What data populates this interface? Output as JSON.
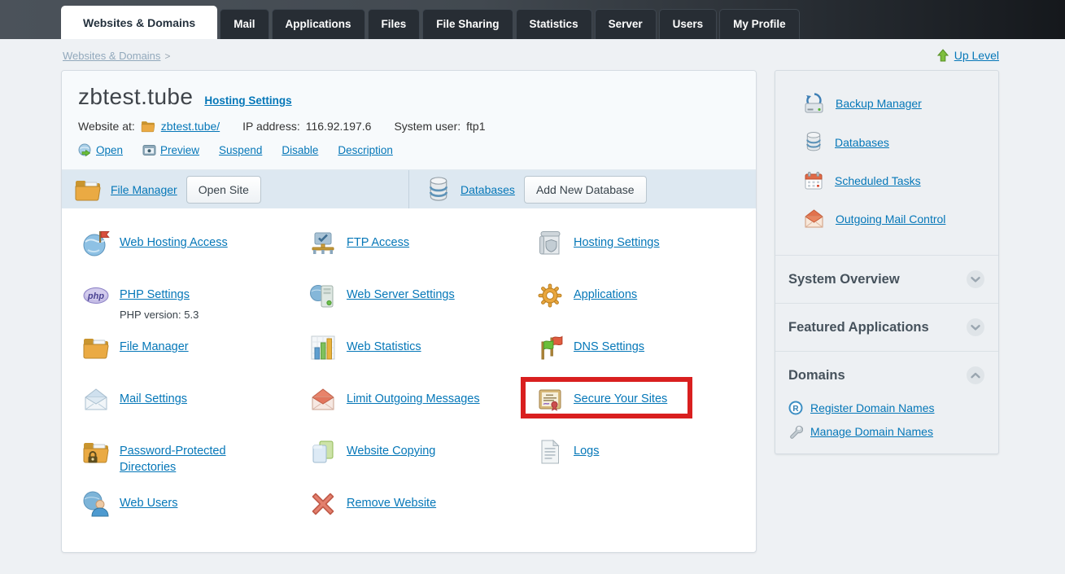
{
  "header": {
    "tabs": [
      {
        "label": "Websites & Domains",
        "active": true
      },
      {
        "label": "Mail",
        "active": false
      },
      {
        "label": "Applications",
        "active": false
      },
      {
        "label": "Files",
        "active": false
      },
      {
        "label": "File Sharing",
        "active": false
      },
      {
        "label": "Statistics",
        "active": false
      },
      {
        "label": "Server",
        "active": false
      },
      {
        "label": "Users",
        "active": false
      },
      {
        "label": "My Profile",
        "active": false
      }
    ]
  },
  "breadcrumb": {
    "current": "Websites & Domains",
    "separator": ">",
    "up_level": "Up Level"
  },
  "domain_card": {
    "title": "zbtest.tube",
    "hosting_settings_link": "Hosting Settings",
    "website_at_label": "Website at:",
    "website_path": "zbtest.tube/",
    "ip_label": "IP address:",
    "ip_value": "116.92.197.6",
    "system_user_label": "System user:",
    "system_user_value": "ftp1",
    "actions": [
      "Open",
      "Preview",
      "Suspend",
      "Disable",
      "Description"
    ],
    "toolbar": {
      "file_manager": "File Manager",
      "open_site": "Open Site",
      "databases": "Databases",
      "add_new_database": "Add New Database"
    },
    "grid": [
      {
        "label": "Web Hosting Access"
      },
      {
        "label": "PHP Settings",
        "sub": "PHP version: 5.3"
      },
      {
        "label": "File Manager"
      },
      {
        "label": "Mail Settings"
      },
      {
        "label": "Password-Protected Directories"
      },
      {
        "label": "Web Users"
      },
      {
        "label": "FTP Access"
      },
      {
        "label": "Web Server Settings"
      },
      {
        "label": "Web Statistics"
      },
      {
        "label": "Limit Outgoing Messages"
      },
      {
        "label": "Website Copying"
      },
      {
        "label": "Remove Website"
      },
      {
        "label": "Hosting Settings"
      },
      {
        "label": "Applications"
      },
      {
        "label": "DNS Settings"
      },
      {
        "label": "Secure Your Sites",
        "highlighted": true
      },
      {
        "label": "Logs"
      }
    ]
  },
  "sidebar": {
    "tools": [
      {
        "label": "Backup Manager"
      },
      {
        "label": "Databases"
      },
      {
        "label": "Scheduled Tasks"
      },
      {
        "label": "Outgoing Mail Control"
      }
    ],
    "sections": [
      {
        "title": "System Overview",
        "state": "collapsed"
      },
      {
        "title": "Featured Applications",
        "state": "collapsed"
      },
      {
        "title": "Domains",
        "state": "expanded"
      }
    ],
    "domains_links": [
      {
        "label": "Register Domain Names"
      },
      {
        "label": "Manage Domain Names"
      }
    ]
  },
  "colors": {
    "link_blue": "#0577b8",
    "annotation_red": "#d91f1f",
    "topbar_dark": "#272d34",
    "toolbar_strip": "#dde8f1",
    "page_background": "#eef1f4"
  }
}
